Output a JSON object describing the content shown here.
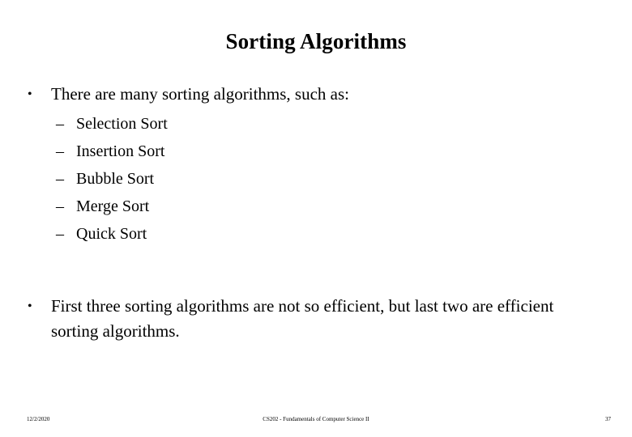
{
  "slide": {
    "title": "Sorting Algorithms",
    "bullets": [
      {
        "marker": "•",
        "text": "There are many sorting algorithms, such as:",
        "sub_marker": "–",
        "sub_items": [
          "Selection Sort",
          "Insertion Sort",
          "Bubble Sort",
          "Merge Sort",
          "Quick Sort"
        ]
      },
      {
        "marker": "•",
        "text": "First three sorting algorithms are not so efficient, but last two are efficient sorting algorithms."
      }
    ],
    "footer": {
      "date": "12/2/2020",
      "center": "CS202 - Fundamentals of Computer Science II",
      "page": "37"
    },
    "colors": {
      "background": "#ffffff",
      "text": "#000000"
    }
  }
}
